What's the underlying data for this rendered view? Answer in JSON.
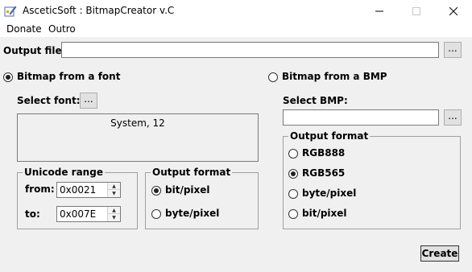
{
  "window": {
    "title": "AsceticSoft : BitmapCreator v.C",
    "controls": {
      "minimize": "—",
      "maximize": "☐",
      "close": "✕"
    }
  },
  "menu": {
    "items": [
      "Donate",
      "Outro"
    ]
  },
  "output_file": {
    "label": "Output file:",
    "value": "",
    "browse_label": "..."
  },
  "font_mode": {
    "radio_label": "Bitmap from a font",
    "selected": true,
    "select_font_label": "Select font:",
    "select_font_button": "...",
    "font_display": "System, 12",
    "unicode_range": {
      "title": "Unicode range",
      "from_label": "from:",
      "from_value": "0x0021",
      "to_label": "to:",
      "to_value": "0x007E"
    },
    "output_format": {
      "title": "Output format",
      "options": [
        {
          "label": "bit/pixel",
          "selected": true
        },
        {
          "label": "byte/pixel",
          "selected": false
        }
      ]
    }
  },
  "bmp_mode": {
    "radio_label": "Bitmap from a BMP",
    "selected": false,
    "select_bmp_label": "Select BMP:",
    "bmp_value": "",
    "browse_label": "...",
    "output_format": {
      "title": "Output format",
      "options": [
        {
          "label": "RGB888",
          "selected": false
        },
        {
          "label": "RGB565",
          "selected": true
        },
        {
          "label": "byte/pixel",
          "selected": false
        },
        {
          "label": "bit/pixel",
          "selected": false
        }
      ]
    }
  },
  "create_button": "Create"
}
